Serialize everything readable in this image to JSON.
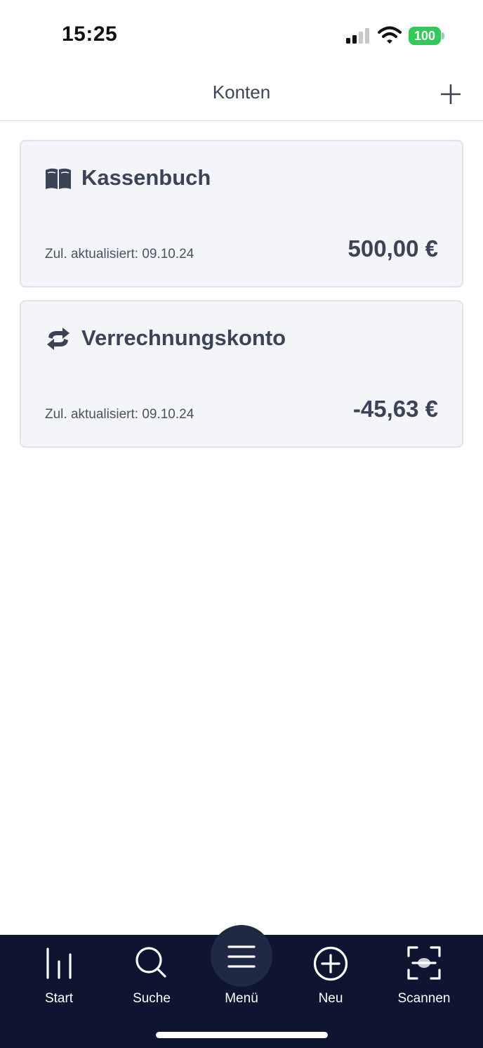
{
  "status_bar": {
    "time": "15:25",
    "battery": "100",
    "icons": [
      "signal-icon",
      "wifi-icon",
      "battery-icon"
    ],
    "battery_color": "#34c759"
  },
  "header": {
    "title": "Konten",
    "add_icon": "plus-icon"
  },
  "accounts": [
    {
      "icon": "book-icon",
      "name": "Kassenbuch",
      "updated": "Zul. aktualisiert: 09.10.24",
      "balance": "500,00 €"
    },
    {
      "icon": "transfer-icon",
      "name": "Verrechnungskonto",
      "updated": "Zul. aktualisiert: 09.10.24",
      "balance": "-45,63 €"
    }
  ],
  "tab_bar": {
    "background": "#0e1530",
    "items": [
      {
        "label": "Start",
        "icon": "bar-chart-icon"
      },
      {
        "label": "Suche",
        "icon": "search-icon"
      },
      {
        "label": "Menü",
        "icon": "menu-icon"
      },
      {
        "label": "Neu",
        "icon": "plus-circle-icon"
      },
      {
        "label": "Scannen",
        "icon": "scan-icon"
      }
    ]
  }
}
